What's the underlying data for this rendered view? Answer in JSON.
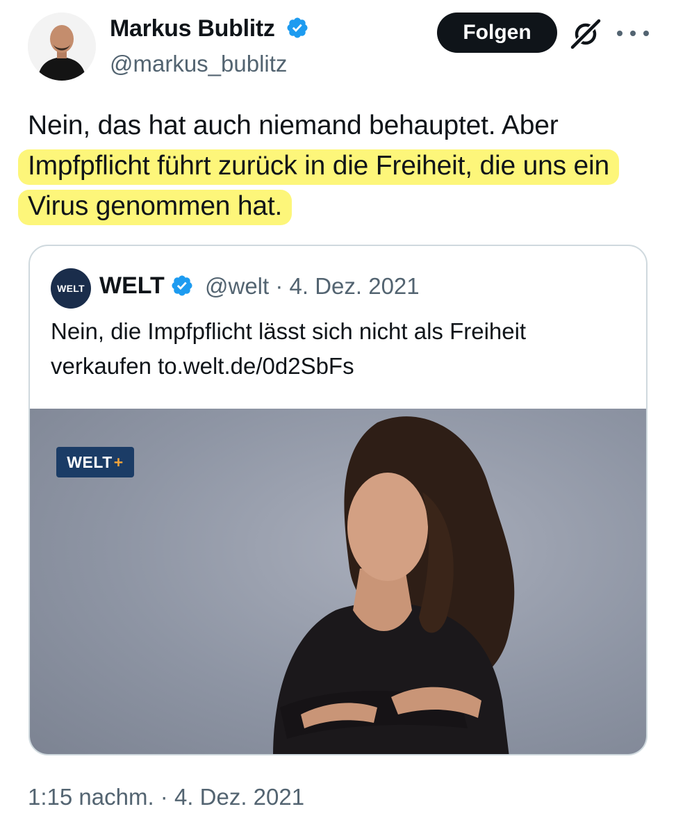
{
  "author": {
    "name": "Markus Bublitz",
    "handle": "@markus_bublitz",
    "verified": true
  },
  "actions": {
    "follow_label": "Folgen",
    "grok_icon": "grok-icon",
    "more_icon": "more-options-icon"
  },
  "tweet": {
    "text_plain": "Nein, das hat auch niemand behauptet. Aber",
    "text_highlighted": "Impfpflicht führt zurück in die Freiheit, die uns ein Virus genommen hat.",
    "highlight_color": "#fdf67a",
    "timestamp": "1:15 nachm. · 4. Dez. 2021"
  },
  "quote": {
    "avatar_text": "WELT",
    "name": "WELT",
    "verified": true,
    "meta": "@welt · 4. Dez. 2021",
    "text": "Nein, die Impfpflicht lässt sich nicht als Freiheit verkaufen to.welt.de/0d2SbFs",
    "media": {
      "badge_text": "WELT",
      "badge_plus": "+"
    }
  },
  "colors": {
    "verified_blue": "#1d9bf0",
    "secondary_text": "#536471",
    "border": "#cfd9de"
  }
}
